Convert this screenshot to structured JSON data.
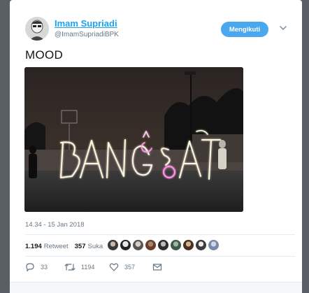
{
  "author": {
    "name": "Imam Supriadi",
    "handle": "@ImamSupriadiBPK"
  },
  "follow_button": {
    "label": "Mengikuti"
  },
  "tweet": {
    "text": "MOOD",
    "image_light_text": "BANGSAT",
    "timestamp": "14.34 - 15 Jan 2018"
  },
  "stats": {
    "retweets_count": "1.194",
    "retweets_label": "Retweet",
    "likes_count": "357",
    "likes_label": "Suka"
  },
  "actions": {
    "replies": "33",
    "retweets": "1194",
    "likes": "357"
  },
  "colors": {
    "accent": "#1da1f2",
    "follow_button": "#4aa9ee",
    "muted_text": "#657786"
  },
  "icons": {
    "reply": "reply-icon",
    "retweet": "retweet-icon",
    "like": "heart-icon",
    "dm": "envelope-icon",
    "caret": "chevron-down-icon"
  }
}
